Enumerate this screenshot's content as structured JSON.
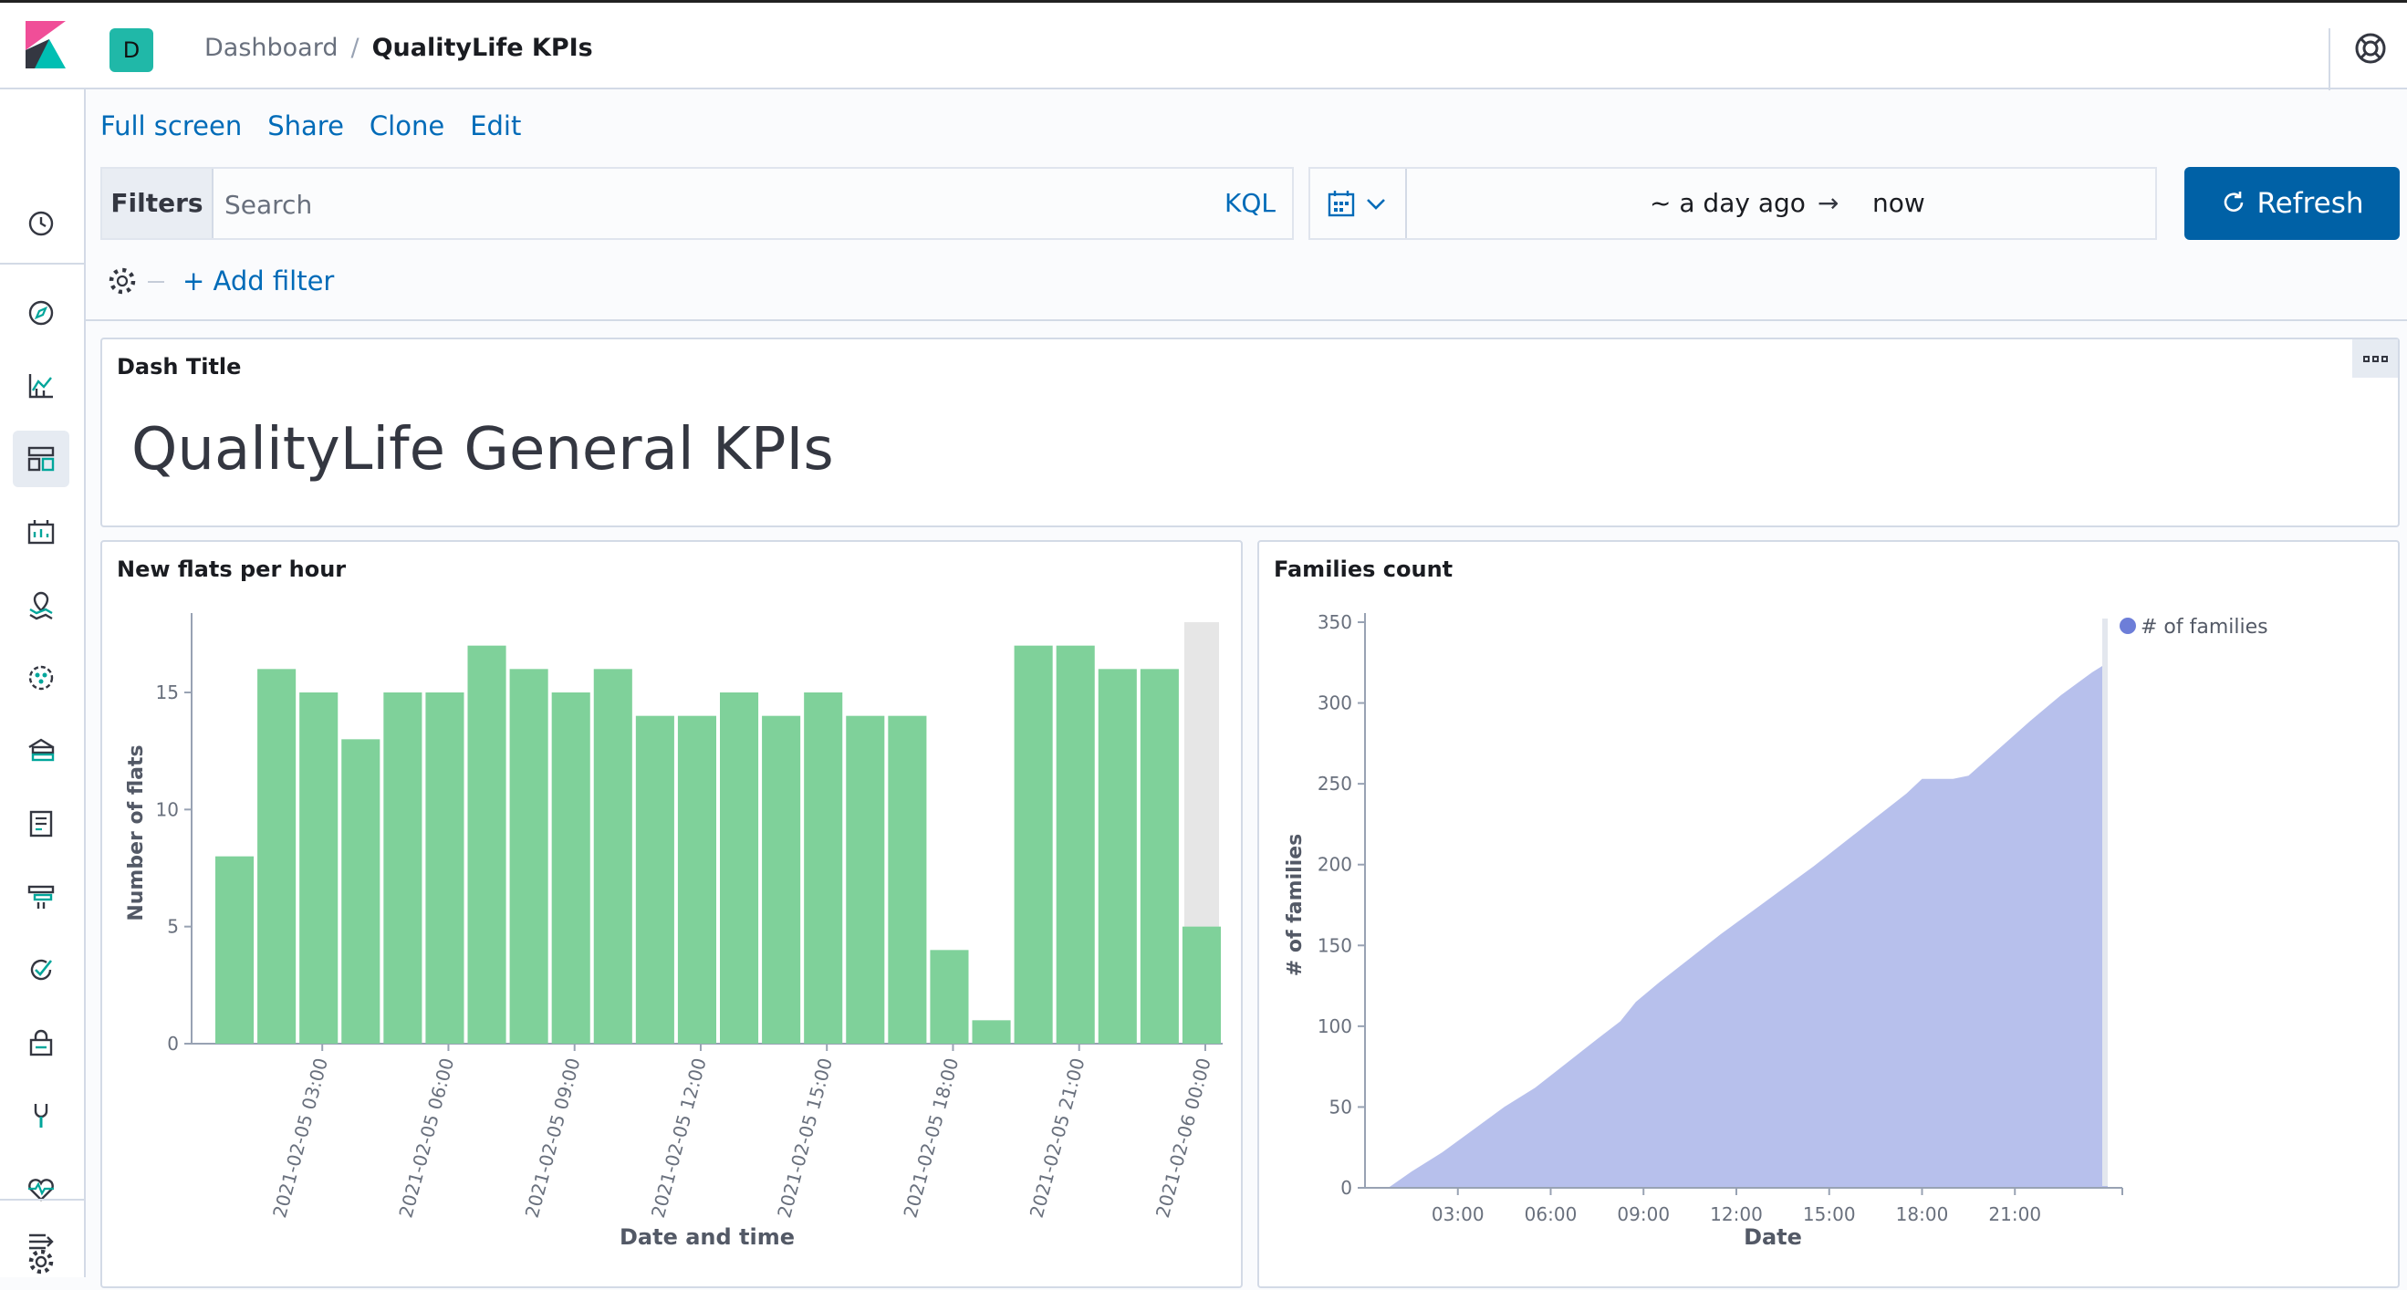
{
  "header": {
    "space_initial": "D",
    "breadcrumb_parent": "Dashboard",
    "breadcrumb_separator": "/",
    "breadcrumb_current": "QualityLife KPIs"
  },
  "sidebar": {
    "items": [
      {
        "name": "recently-viewed-icon"
      },
      {
        "name": "discover-icon"
      },
      {
        "name": "visualize-icon"
      },
      {
        "name": "dashboard-icon",
        "active": true
      },
      {
        "name": "canvas-icon"
      },
      {
        "name": "maps-icon"
      },
      {
        "name": "machine-learning-icon"
      },
      {
        "name": "infrastructure-icon"
      },
      {
        "name": "logs-icon"
      },
      {
        "name": "apm-icon"
      },
      {
        "name": "uptime-icon"
      },
      {
        "name": "siem-icon"
      },
      {
        "name": "dev-tools-icon"
      },
      {
        "name": "stack-monitoring-icon"
      },
      {
        "name": "management-icon"
      },
      {
        "name": "collapse-menu-icon"
      }
    ]
  },
  "actions": {
    "full_screen": "Full screen",
    "share": "Share",
    "clone": "Clone",
    "edit": "Edit"
  },
  "filter_bar": {
    "filters_label": "Filters",
    "search_placeholder": "Search",
    "kql_label": "KQL",
    "add_filter": "+ Add filter"
  },
  "time_picker": {
    "start": "~ a day ago",
    "arrow": "→",
    "end": "now",
    "refresh_label": "Refresh"
  },
  "panels": {
    "title_panel": {
      "title": "Dash Title",
      "heading": "QualityLife General KPIs"
    }
  },
  "colors": {
    "accent": "#006bb8",
    "refresh_button": "#0061a6",
    "bar_fill": "#7fd19a",
    "area_fill": "#b7c0ec",
    "legend_dot": "#6d7ed8"
  },
  "chart_data": [
    {
      "type": "bar",
      "title": "New flats per hour",
      "xlabel": "Date and time",
      "ylabel": "Number of flats",
      "ylim": [
        0,
        18
      ],
      "yticks": [
        0,
        5,
        10,
        15
      ],
      "x_tick_labels": [
        "2021-02-05 03:00",
        "2021-02-05 06:00",
        "2021-02-05 09:00",
        "2021-02-05 12:00",
        "2021-02-05 15:00",
        "2021-02-05 18:00",
        "2021-02-05 21:00",
        "2021-02-06 00:00"
      ],
      "categories": [
        "2021-02-05 01:00",
        "2021-02-05 02:00",
        "2021-02-05 03:00",
        "2021-02-05 04:00",
        "2021-02-05 05:00",
        "2021-02-05 06:00",
        "2021-02-05 07:00",
        "2021-02-05 08:00",
        "2021-02-05 09:00",
        "2021-02-05 10:00",
        "2021-02-05 11:00",
        "2021-02-05 12:00",
        "2021-02-05 13:00",
        "2021-02-05 14:00",
        "2021-02-05 15:00",
        "2021-02-05 16:00",
        "2021-02-05 17:00",
        "2021-02-05 18:00",
        "2021-02-05 19:00",
        "2021-02-05 20:00",
        "2021-02-05 21:00",
        "2021-02-05 22:00",
        "2021-02-05 23:00",
        "2021-02-06 00:00"
      ],
      "values": [
        8,
        16,
        15,
        13,
        15,
        15,
        17,
        16,
        15,
        16,
        14,
        14,
        15,
        14,
        15,
        14,
        14,
        4,
        1,
        17,
        17,
        16,
        16,
        5
      ],
      "partial_last_bucket": true
    },
    {
      "type": "area",
      "title": "Families count",
      "xlabel": "Date",
      "ylabel": "# of families",
      "ylim": [
        0,
        350
      ],
      "yticks": [
        0,
        50,
        100,
        150,
        200,
        250,
        300,
        350
      ],
      "x_tick_labels": [
        "03:00",
        "06:00",
        "09:00",
        "12:00",
        "15:00",
        "18:00",
        "21:00"
      ],
      "legend": "top-right",
      "series": [
        {
          "name": "# of families",
          "x": [
            "00:45",
            "01:30",
            "02:30",
            "03:30",
            "04:30",
            "05:30",
            "06:30",
            "07:30",
            "08:15",
            "08:45",
            "09:30",
            "10:30",
            "11:30",
            "12:30",
            "13:30",
            "14:30",
            "15:30",
            "16:30",
            "17:30",
            "18:00",
            "19:00",
            "19:30",
            "20:30",
            "21:30",
            "22:30",
            "23:30",
            "24:00"
          ],
          "y": [
            0,
            10,
            22,
            36,
            50,
            62,
            77,
            92,
            103,
            115,
            127,
            142,
            157,
            171,
            185,
            199,
            214,
            229,
            244,
            253,
            253,
            255,
            272,
            289,
            305,
            319,
            325
          ]
        }
      ]
    }
  ]
}
